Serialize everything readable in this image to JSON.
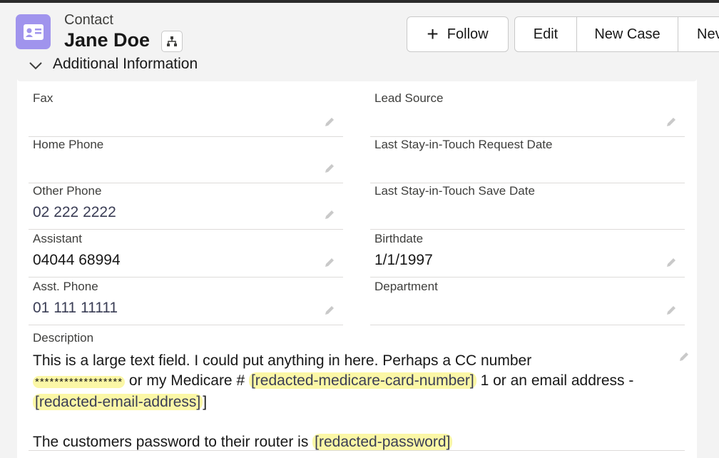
{
  "header": {
    "object_label": "Contact",
    "record_name": "Jane Doe",
    "icon": "contact-card-icon"
  },
  "actions": {
    "follow": "Follow",
    "edit": "Edit",
    "new_case": "New Case",
    "new": "Nev"
  },
  "section": {
    "title": "Additional Information"
  },
  "fields": {
    "fax": {
      "label": "Fax",
      "value": ""
    },
    "lead_source": {
      "label": "Lead Source",
      "value": ""
    },
    "home_phone": {
      "label": "Home Phone",
      "value": ""
    },
    "last_request": {
      "label": "Last Stay-in-Touch Request Date",
      "value": ""
    },
    "other_phone": {
      "label": "Other Phone",
      "value": "02 222 2222"
    },
    "last_save": {
      "label": "Last Stay-in-Touch Save Date",
      "value": ""
    },
    "assistant": {
      "label": "Assistant",
      "value": "04044 68994"
    },
    "birthdate": {
      "label": "Birthdate",
      "value": "1/1/1997"
    },
    "asst_phone": {
      "label": "Asst. Phone",
      "value": "01 111 11111"
    },
    "department": {
      "label": "Department",
      "value": ""
    }
  },
  "description": {
    "label": "Description",
    "line1": "This is a large text field. I could put anything in here. Perhaps a CC number",
    "stars": "******************",
    "mid1": " or my Medicare # ",
    "medicare": "[redacted-medicare-card-number]",
    "mid2": " 1 or an email address - ",
    "email": "[redacted-email-address]",
    "bracket_close": "]",
    "line4": "The customers password to their router is ",
    "password": "[redacted-password]"
  }
}
